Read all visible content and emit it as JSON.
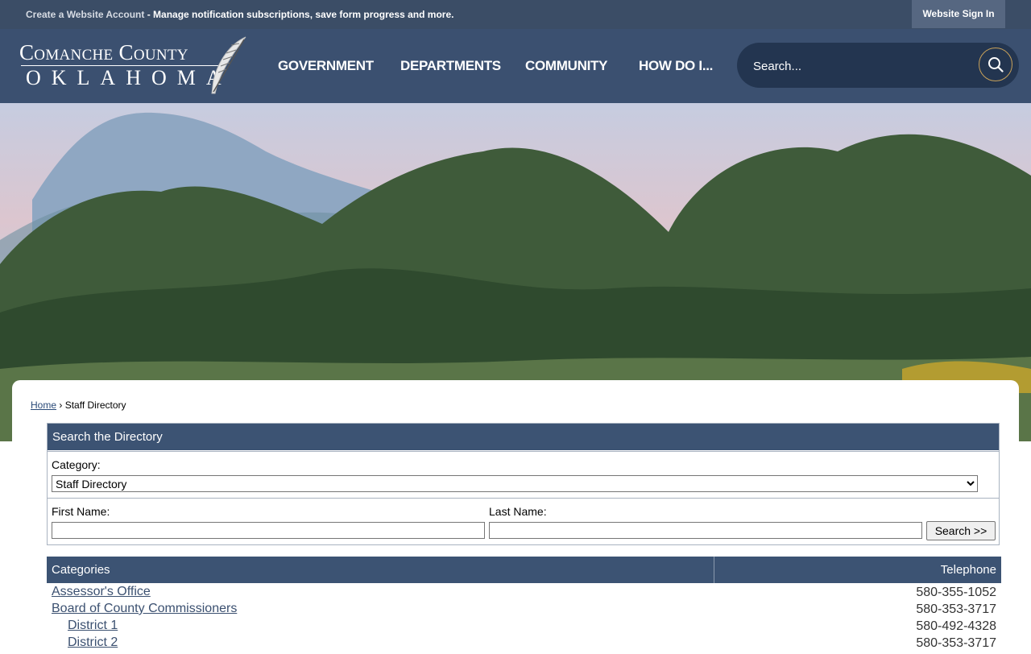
{
  "topbar": {
    "create_link": "Create a Website Account",
    "create_text": " - Manage notification subscriptions, save form progress and more.",
    "signin_label": "Website Sign In"
  },
  "logo": {
    "line1": "Comanche County",
    "line2": "Oklahoma"
  },
  "nav": {
    "items": [
      "GOVERNMENT",
      "DEPARTMENTS",
      "COMMUNITY",
      "HOW DO I..."
    ]
  },
  "search": {
    "placeholder": "Search..."
  },
  "breadcrumb": {
    "home": "Home",
    "separator": "›",
    "current": "Staff Directory"
  },
  "directory_search": {
    "title": "Search the Directory",
    "category_label": "Category:",
    "category_value": "Staff Directory",
    "first_name_label": "First Name:",
    "last_name_label": "Last Name:",
    "first_name_value": "",
    "last_name_value": "",
    "submit_label": "Search >>"
  },
  "categories": {
    "header_col1": "Categories",
    "header_col2": "Telephone",
    "rows": [
      {
        "name": "Assessor's Office",
        "phone": "580-355-1052",
        "indent": false
      },
      {
        "name": "Board of County Commissioners",
        "phone": "580-353-3717",
        "indent": false
      },
      {
        "name": "District 1",
        "phone": "580-492-4328",
        "indent": true
      },
      {
        "name": "District 2",
        "phone": "580-353-3717",
        "indent": true
      }
    ]
  },
  "colors": {
    "header_bg": "#3b5070",
    "topbar_bg": "#3b4d66",
    "table_head": "#3c5373",
    "accent": "#c8a15a"
  }
}
